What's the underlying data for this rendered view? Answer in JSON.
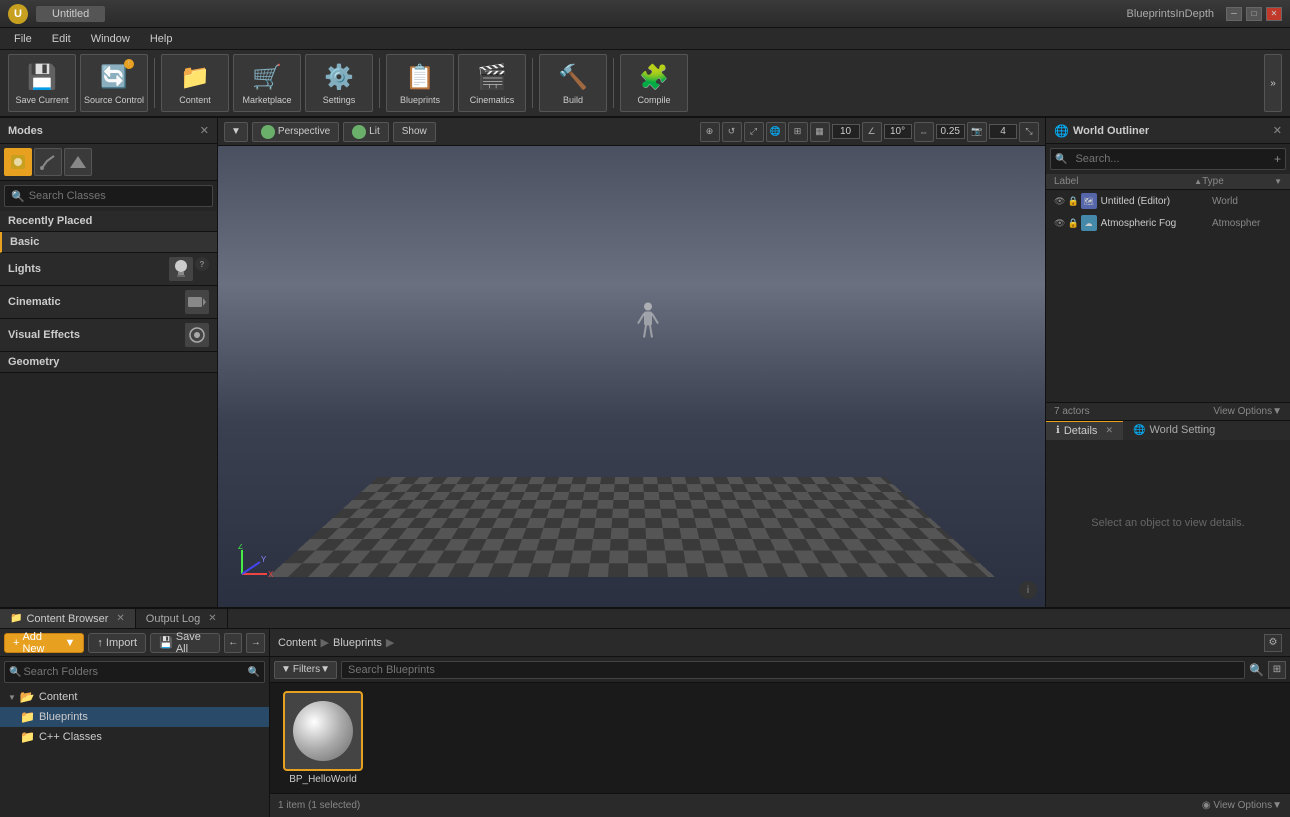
{
  "window": {
    "title": "Untitled",
    "app_name": "BlueprintsInDepth"
  },
  "menubar": {
    "items": [
      "File",
      "Edit",
      "Window",
      "Help"
    ]
  },
  "toolbar": {
    "buttons": [
      {
        "label": "Save Current",
        "icon": "💾"
      },
      {
        "label": "Source Control",
        "icon": "🔄"
      },
      {
        "label": "Content",
        "icon": "📁"
      },
      {
        "label": "Marketplace",
        "icon": "🛒"
      },
      {
        "label": "Settings",
        "icon": "⚙"
      },
      {
        "label": "Blueprints",
        "icon": "🎬"
      },
      {
        "label": "Cinematics",
        "icon": "🎥"
      },
      {
        "label": "Build",
        "icon": "🔨"
      },
      {
        "label": "Compile",
        "icon": "🧩"
      }
    ],
    "expand_label": "»"
  },
  "modes": {
    "title": "Modes",
    "search_placeholder": "Search Classes"
  },
  "viewport": {
    "perspective_label": "Perspective",
    "lit_label": "Lit",
    "show_label": "Show",
    "numbers": {
      "first": "10",
      "angle": "10°",
      "decimal": "0.25",
      "last": "4"
    }
  },
  "outliner": {
    "title": "World Outliner",
    "search_placeholder": "Search...",
    "col_label": "Label",
    "col_type": "Type",
    "items": [
      {
        "name": "Untitled (Editor)",
        "type": "World"
      },
      {
        "name": "Atmospheric Fog",
        "type": "Atmospher"
      }
    ],
    "actor_count": "7 actors",
    "view_options": "View Options▼"
  },
  "details": {
    "tabs": [
      "Details",
      "World Setting"
    ],
    "placeholder": "Select an object to view details."
  },
  "bottom": {
    "tabs": [
      "Content Browser",
      "Output Log"
    ],
    "active_tab": "Content Browser"
  },
  "folder_toolbar": {
    "add_new": "Add New",
    "import": "Import",
    "save_all": "Save All"
  },
  "path": {
    "items": [
      "Content",
      "Blueprints"
    ]
  },
  "filter": {
    "label": "Filters▼",
    "search_placeholder": "Search Blueprints"
  },
  "tree": {
    "items": [
      {
        "label": "Content",
        "type": "root",
        "indent": 0
      },
      {
        "label": "Blueprints",
        "type": "folder",
        "indent": 1,
        "selected": true
      },
      {
        "label": "C++ Classes",
        "type": "folder",
        "indent": 1
      }
    ]
  },
  "assets": [
    {
      "name": "BP_HelloWorld",
      "selected": true
    }
  ],
  "cb_footer": {
    "count": "1 item (1 selected)",
    "view_options": "◉ View Options▼"
  },
  "search_folders_placeholder": "Search Folders"
}
